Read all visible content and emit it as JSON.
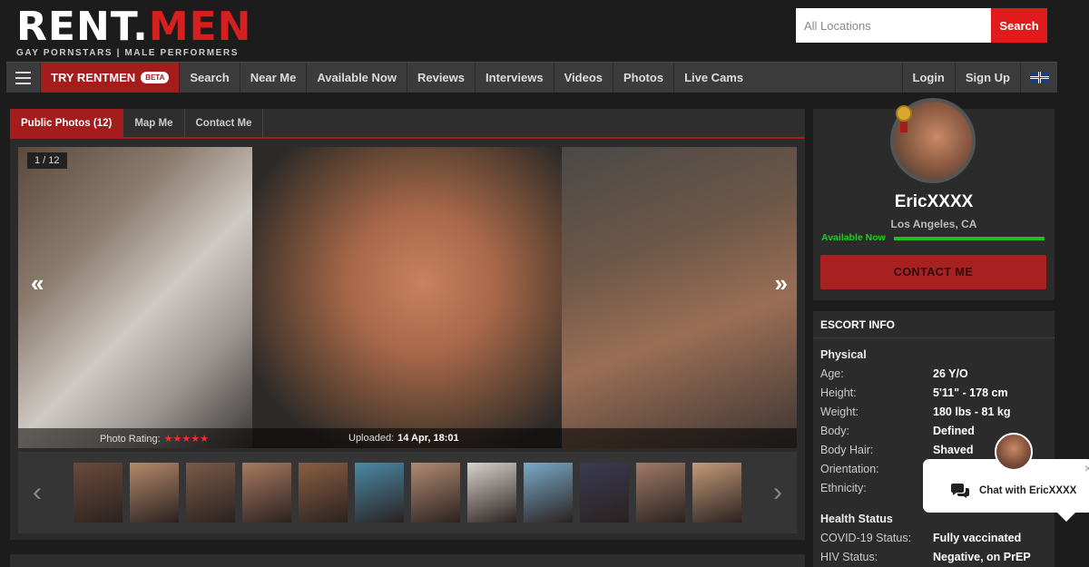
{
  "header": {
    "logo_left": "RENT.",
    "logo_right": "MEN",
    "logo_tagline": "GAY PORNSTARS | MALE PERFORMERS",
    "search_placeholder": "All Locations",
    "search_button": "Search"
  },
  "nav": {
    "try_label": "TRY RENTMEN",
    "beta_label": "BETA",
    "items": [
      "Search",
      "Near Me",
      "Available Now",
      "Reviews",
      "Interviews",
      "Videos",
      "Photos",
      "Live Cams"
    ],
    "login": "Login",
    "signup": "Sign Up"
  },
  "tabs": [
    "Public Photos (12)",
    "Map Me",
    "Contact Me"
  ],
  "gallery": {
    "counter": "1 / 12",
    "rating_label": "Photo Rating:",
    "rating_stars": 5,
    "uploaded_label": "Uploaded:",
    "uploaded_value": "14 Apr, 18:01",
    "thumb_count": 12,
    "thumb_colors": [
      "#6b4a3a",
      "#b58a6a",
      "#7a5a48",
      "#a87a60",
      "#8a5e42",
      "#4a8aa6",
      "#b28a72",
      "#d8d2cc",
      "#7aaac8",
      "#3a3a52",
      "#a07a66",
      "#c49a7a"
    ]
  },
  "profile": {
    "name": "EricXXXX",
    "location": "Los Angeles, CA",
    "availability": "Available Now",
    "contact_button": "CONTACT ME"
  },
  "escort_info": {
    "header": "ESCORT INFO",
    "physical_title": "Physical",
    "physical": [
      {
        "k": "Age:",
        "v": "26 Y/O"
      },
      {
        "k": "Height:",
        "v": "5'11\" - 178 cm"
      },
      {
        "k": "Weight:",
        "v": "180 lbs - 81 kg"
      },
      {
        "k": "Body:",
        "v": "Defined"
      },
      {
        "k": "Body Hair:",
        "v": "Shaved"
      },
      {
        "k": "Orientation:",
        "v": ""
      },
      {
        "k": "Ethnicity:",
        "v": ""
      }
    ],
    "health_title": "Health Status",
    "health": [
      {
        "k": "COVID-19 Status:",
        "v": "Fully vaccinated"
      },
      {
        "k": "HIV Status:",
        "v": "Negative, on PrEP"
      }
    ]
  },
  "chat": {
    "label": "Chat with EricXXXX",
    "close_symbol": "×"
  },
  "colors": {
    "accent": "#a51c1c",
    "search_red": "#e01b1b",
    "available_green": "#1bc21b"
  }
}
